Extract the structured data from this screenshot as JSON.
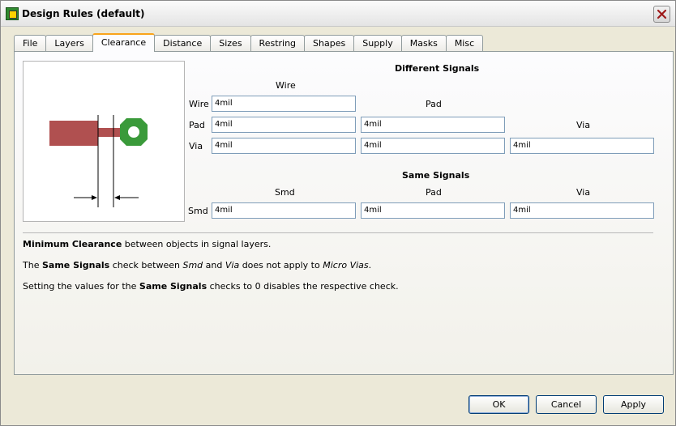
{
  "window": {
    "title": "Design Rules (default)"
  },
  "tabs": [
    "File",
    "Layers",
    "Clearance",
    "Distance",
    "Sizes",
    "Restring",
    "Shapes",
    "Supply",
    "Masks",
    "Misc"
  ],
  "active_tab": "Clearance",
  "different_signals": {
    "title": "Different Signals",
    "col_wire": "Wire",
    "col_pad": "Pad",
    "col_via": "Via",
    "row_wire": "Wire",
    "row_pad": "Pad",
    "row_via": "Via",
    "wire_wire": "4mil",
    "pad_wire": "4mil",
    "pad_pad": "4mil",
    "via_wire": "4mil",
    "via_pad": "4mil",
    "via_via": "4mil"
  },
  "same_signals": {
    "title": "Same Signals",
    "col_smd": "Smd",
    "col_pad": "Pad",
    "col_via": "Via",
    "row_smd": "Smd",
    "smd_smd": "4mil",
    "smd_pad": "4mil",
    "smd_via": "4mil"
  },
  "notes": {
    "n1_bold": "Minimum Clearance",
    "n1_rest": " between objects in signal layers.",
    "n2_a": "The ",
    "n2_bold": "Same Signals",
    "n2_b": " check between ",
    "n2_smd": "Smd",
    "n2_c": " and ",
    "n2_via": "Via",
    "n2_d": " does not apply to ",
    "n2_micro": "Micro Vias",
    "n2_e": ".",
    "n3_a": "Setting the values for the ",
    "n3_bold": "Same Signals",
    "n3_b": " checks to 0 disables the respective check."
  },
  "buttons": {
    "ok": "OK",
    "cancel": "Cancel",
    "apply": "Apply"
  },
  "colors": {
    "wire": "#b05050",
    "pad": "#3a9a3a",
    "tab_accent": "#f9a31a"
  }
}
